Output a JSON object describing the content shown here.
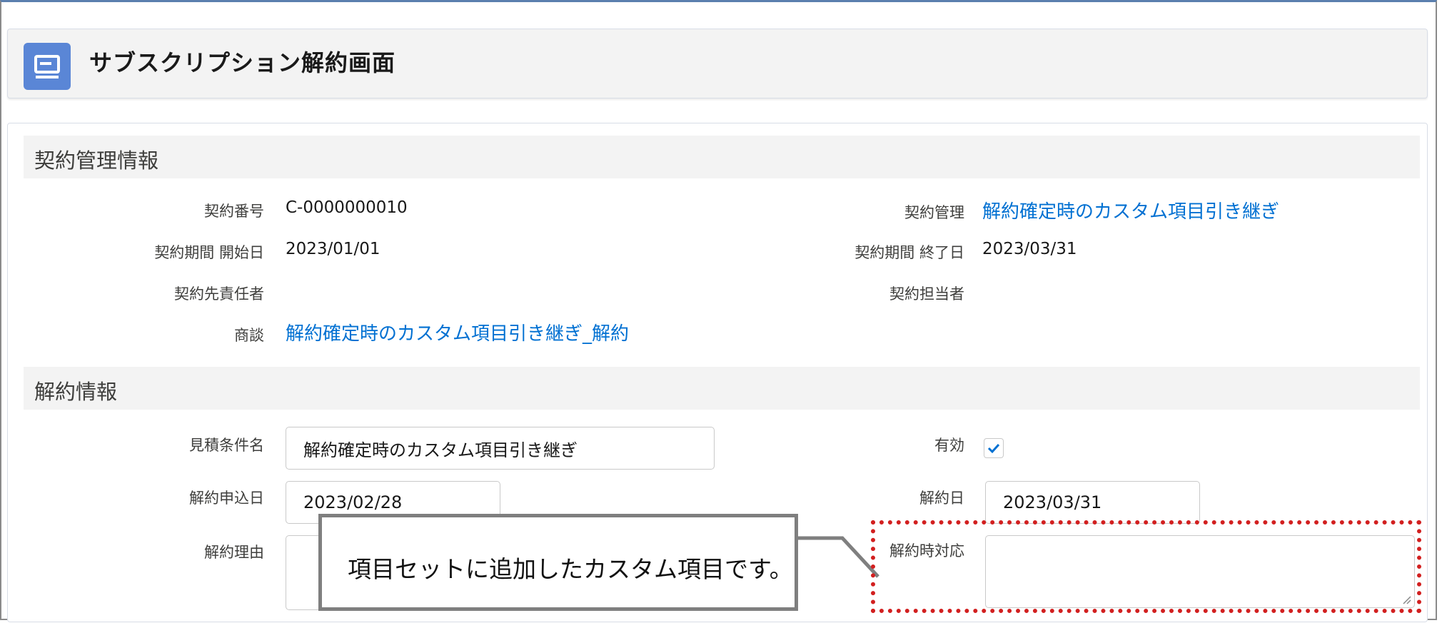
{
  "header": {
    "title": "サブスクリプション解約画面",
    "icon": "record-icon",
    "icon_color": "#5a86d6"
  },
  "sections": {
    "contract": {
      "title": "契約管理情報",
      "contract_number_label": "契約番号",
      "contract_number_value": "C-0000000010",
      "contract_mgmt_label": "契約管理",
      "contract_mgmt_value": "解約確定時のカスタム項目引き継ぎ",
      "start_date_label": "契約期間 開始日",
      "start_date_value": "2023/01/01",
      "end_date_label": "契約期間 終了日",
      "end_date_value": "2023/03/31",
      "responsible_label": "契約先責任者",
      "owner_label": "契約担当者",
      "deal_label": "商談",
      "deal_value": "解約確定時のカスタム項目引き継ぎ_解約"
    },
    "cancel": {
      "title": "解約情報",
      "quote_label": "見積条件名",
      "quote_value": "解約確定時のカスタム項目引き継ぎ",
      "active_label": "有効",
      "active_checked": true,
      "apply_date_label": "解約申込日",
      "apply_date_value": "2023/02/28",
      "cancel_date_label": "解約日",
      "cancel_date_value": "2023/03/31",
      "reason_label": "解約理由",
      "response_label": "解約時対応"
    }
  },
  "callout": {
    "text": "項目セットに追加したカスタム項目です。"
  },
  "colors": {
    "link": "#0070d2",
    "highlight": "#d21f1f",
    "section_bg": "#f3f3f3"
  }
}
